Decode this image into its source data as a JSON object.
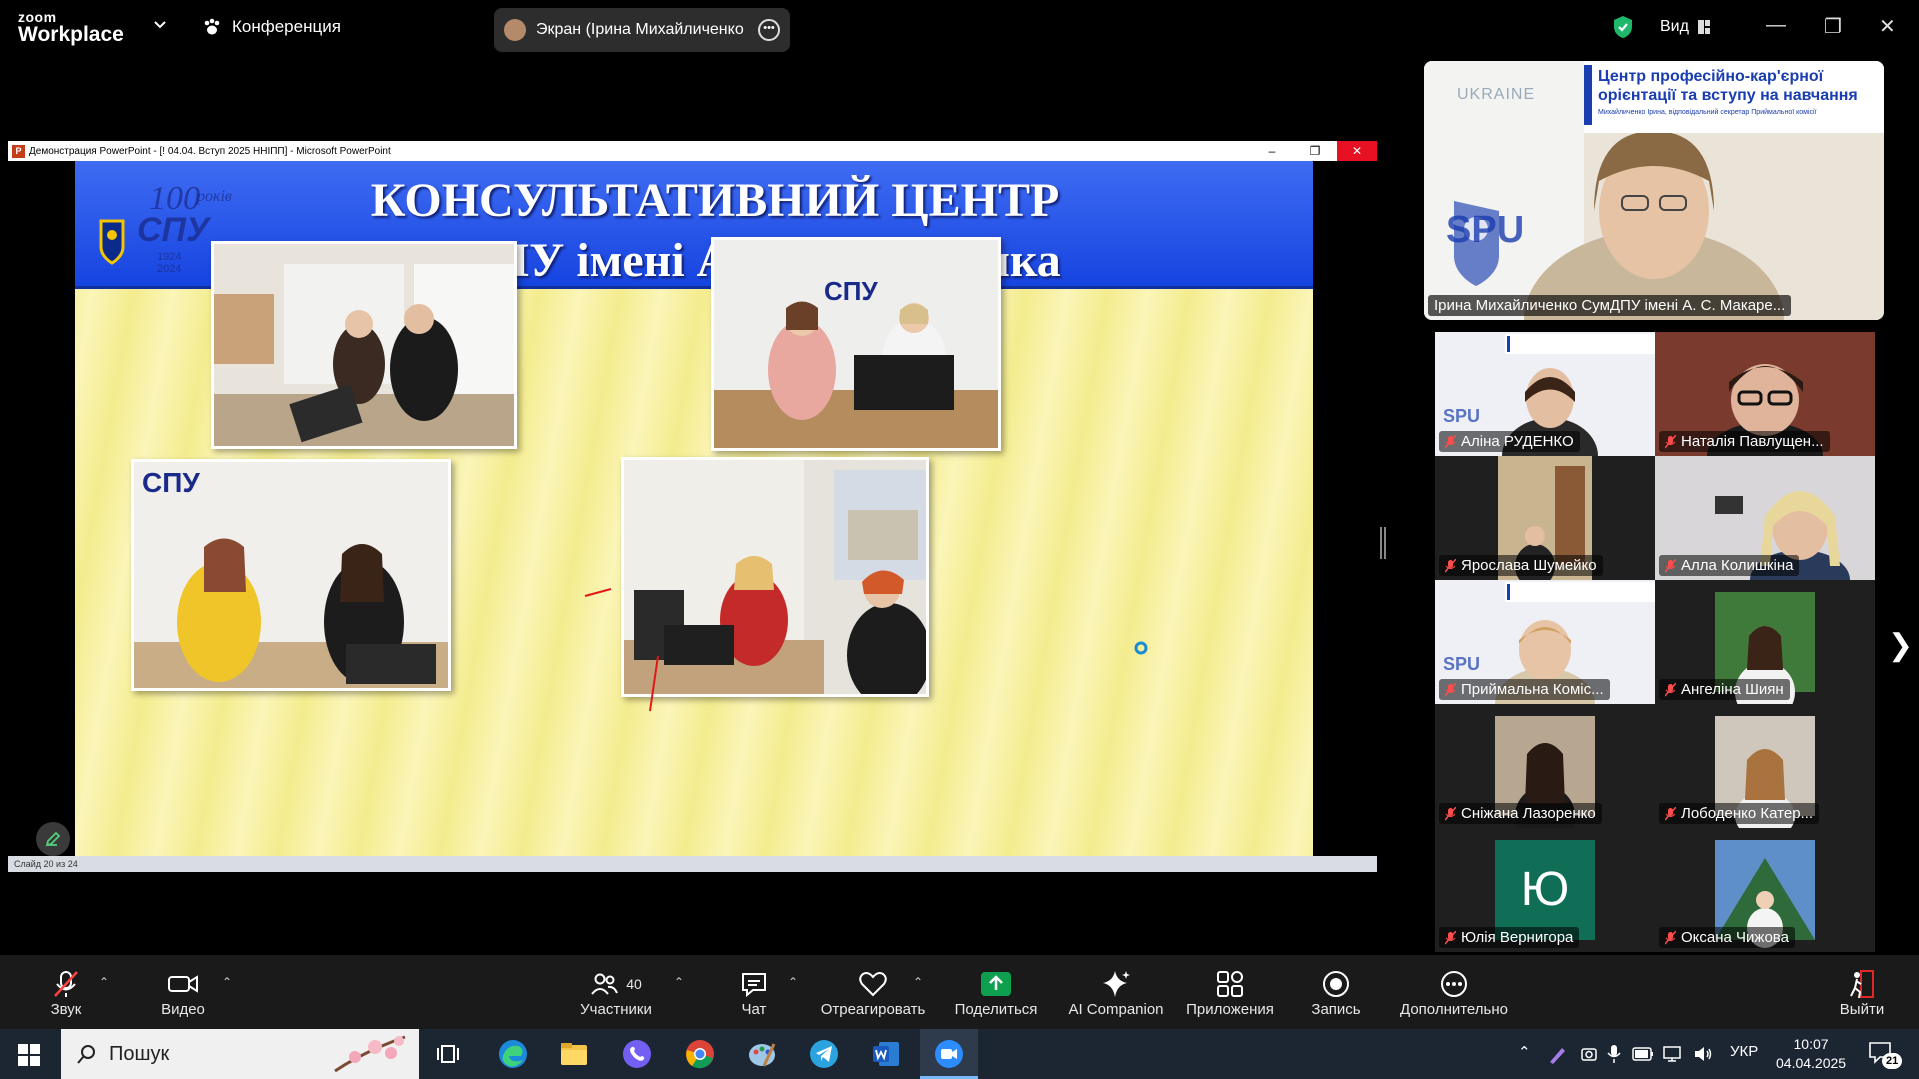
{
  "app": {
    "logo_line1": "zoom",
    "logo_line2": "Workplace",
    "meeting_menu": "Конференция",
    "share_label": "Экран (Ірина Михайличенко Су",
    "view_label": "Вид"
  },
  "ppt": {
    "window_title": "Демонстрация PowerPoint - [! 04.04. Вступ 2025 ННІПП] - Microsoft PowerPoint",
    "status_text": "Слайд 20 из 24",
    "slide_title_line1": "КОНСУЛЬТАТИВНИЙ ЦЕНТР",
    "slide_title_line2": "СумДПУ імені А. С. Макаренка",
    "logo_text": "СПУ",
    "logo_years": "1924 2024",
    "photo_sign_1": "СПУ",
    "photo_sign_2": "СПУ"
  },
  "speaker": {
    "banner_title_line1": "Центр професійно-кар'єрної",
    "banner_title_line2": "орієнтації та вступу на навчання",
    "banner_subtitle": "Михайличенко Ірина, відповідальний секретар Приймальної комісії",
    "ukraine_label": "UKRAINE",
    "brand_label": "SPU",
    "name": "Ірина Михайличенко СумДПУ імені А. С. Макаре..."
  },
  "participants": [
    {
      "name": "Аліна РУДЕНКО",
      "muted": true
    },
    {
      "name": "Наталія Павлущен...",
      "muted": true
    },
    {
      "name": "Ярослава Шумейко",
      "muted": true
    },
    {
      "name": "Алла Колишкіна",
      "muted": true
    },
    {
      "name": "Приймальна Коміс...",
      "muted": true
    },
    {
      "name": "Ангеліна Шиян",
      "muted": true
    },
    {
      "name": "Сніжана Лазоренко",
      "muted": true
    },
    {
      "name": "Лободенко Катер...",
      "muted": true
    },
    {
      "name": "Юлія Вернигора",
      "muted": true,
      "initial": "Ю"
    },
    {
      "name": "Оксана Чижова",
      "muted": true
    }
  ],
  "toolbar": {
    "audio": "Звук",
    "video": "Видео",
    "participants": "Участники",
    "participants_count": "40",
    "chat": "Чат",
    "react": "Отреагировать",
    "share": "Поделиться",
    "ai": "AI Companion",
    "apps": "Приложения",
    "record": "Запись",
    "more": "Дополнительно",
    "leave": "Выйти"
  },
  "taskbar": {
    "search_placeholder": "Пошук",
    "language": "УКР",
    "time": "10:07",
    "date": "04.04.2025",
    "notifications": "21"
  },
  "colors": {
    "zoom_share_green": "#0e9f4f",
    "slide_header_blue": "#1644e0",
    "leave_red": "#e02828"
  }
}
